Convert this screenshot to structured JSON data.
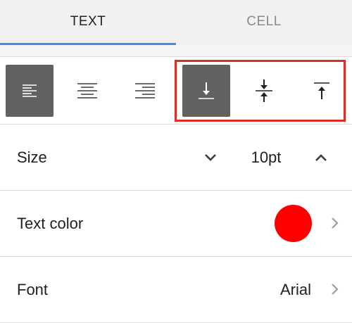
{
  "tabs": [
    {
      "label": "TEXT",
      "active": true
    },
    {
      "label": "CELL",
      "active": false
    }
  ],
  "horizontal_alignment": {
    "options": [
      "align-left-icon",
      "align-center-icon",
      "align-right-icon"
    ],
    "selected": "align-left-icon"
  },
  "vertical_alignment": {
    "options": [
      "align-bottom-icon",
      "align-middle-icon",
      "align-top-icon"
    ],
    "selected": "align-bottom-icon",
    "highlight_color": "#d93025"
  },
  "size": {
    "label": "Size",
    "value": "10pt"
  },
  "text_color": {
    "label": "Text color",
    "color": "#ff0000"
  },
  "font": {
    "label": "Font",
    "value": "Arial"
  },
  "colors": {
    "tab_indicator": "#4a86e8",
    "selected_button": "#616161",
    "divider": "#dadce0"
  }
}
